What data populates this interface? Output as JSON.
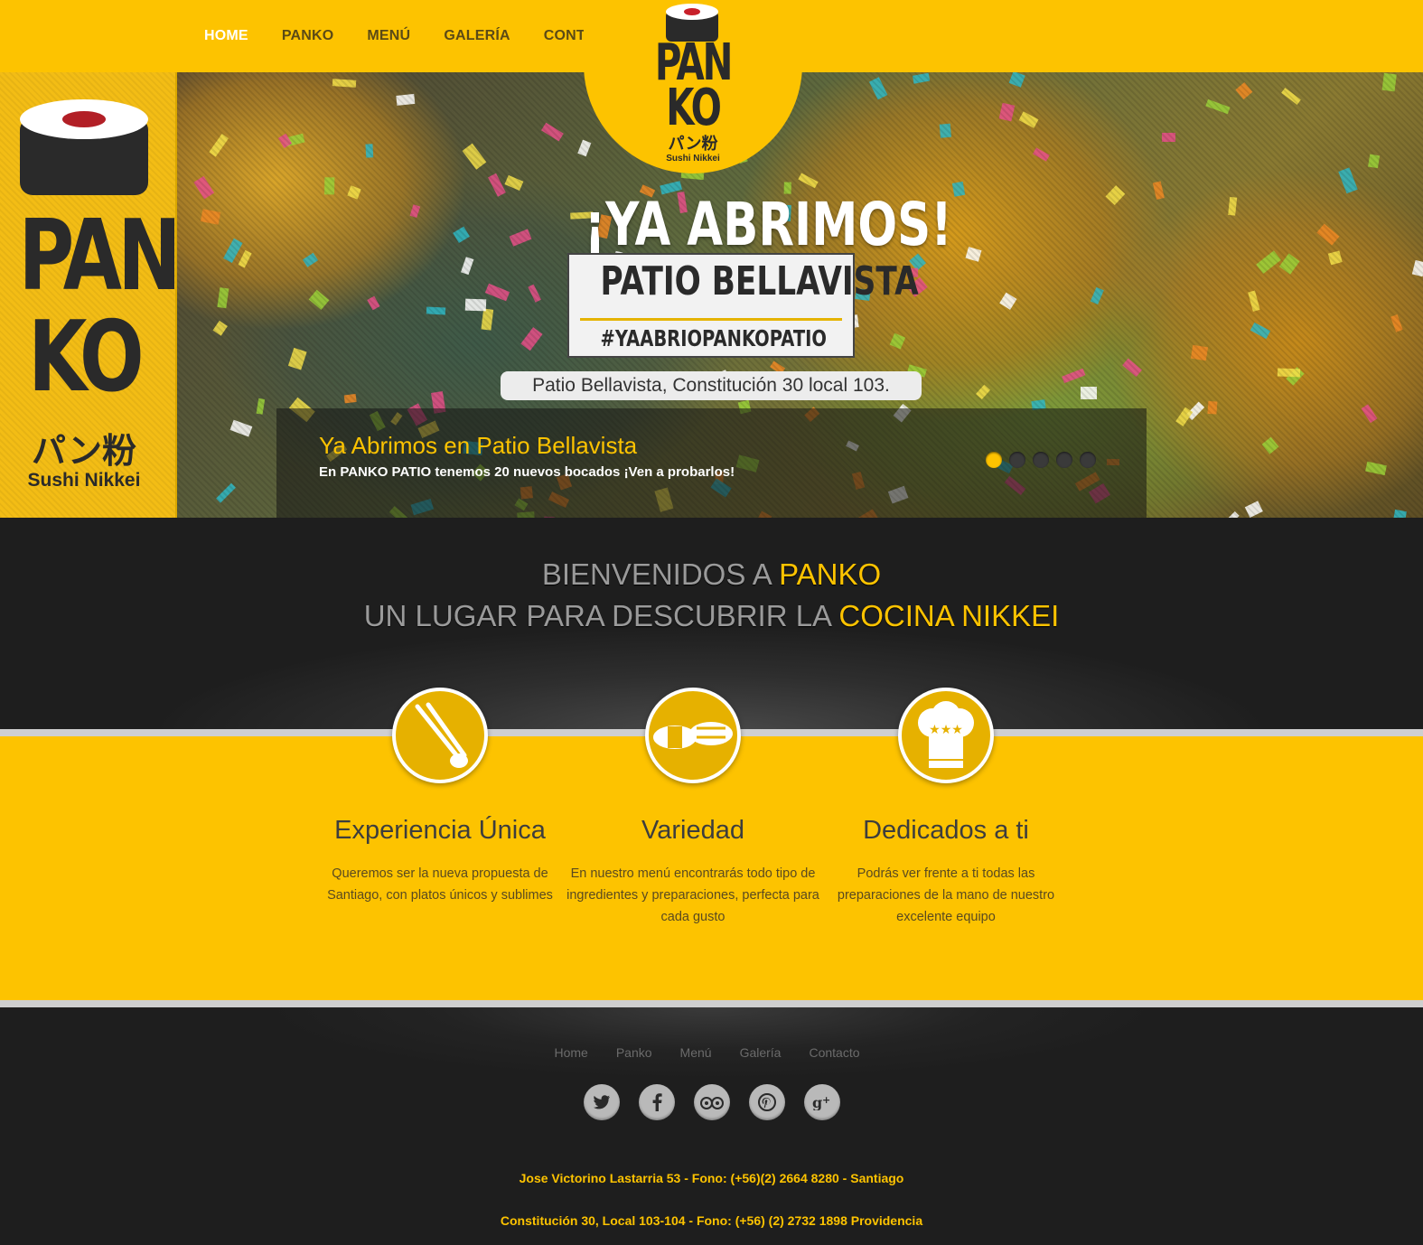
{
  "nav": {
    "items": [
      "HOME",
      "PANKO",
      "MENÚ",
      "GALERÍA",
      "CONTACTO"
    ]
  },
  "brand": {
    "line1": "PAN",
    "line2": "KO",
    "kana": "パン粉",
    "subtitle": "Sushi Nikkei"
  },
  "hero": {
    "title": "¡YA ABRIMOS!",
    "box_title": "PATIO BELLAVISTA",
    "hashtag": "#YAABRIOPANKOPATIO",
    "address": "Patio Bellavista, Constitución 30 local 103.",
    "caption_title": "Ya Abrimos en Patio Bellavista",
    "caption_text": "En PANKO PATIO tenemos 20 nuevos bocados ¡Ven a probarlos!",
    "slide_count": 5,
    "active_slide": 1
  },
  "welcome": {
    "line1_prefix": "BIENVENIDOS A ",
    "line1_highlight": "PANKO",
    "line2_prefix": "UN LUGAR PARA DESCUBRIR LA ",
    "line2_highlight": "COCINA NIKKEI"
  },
  "features": [
    {
      "icon": "chopsticks-icon",
      "title": "Experiencia Única",
      "text": "Queremos ser la nueva propuesta de Santiago, con platos únicos y sublimes"
    },
    {
      "icon": "sushi-icon",
      "title": "Variedad",
      "text": "En nuestro menú encontrarás todo tipo de ingredientes y preparaciones, perfecta para cada gusto"
    },
    {
      "icon": "chef-hat-icon",
      "title": "Dedicados a ti",
      "text": "Podrás ver frente a ti todas las preparaciones de la mano de nuestro excelente equipo"
    }
  ],
  "footer": {
    "nav": [
      "Home",
      "Panko",
      "Menú",
      "Galería",
      "Contacto"
    ],
    "social": [
      "twitter-icon",
      "facebook-icon",
      "tripadvisor-icon",
      "pinterest-icon",
      "google-plus-icon"
    ],
    "address1": "Jose Victorino Lastarria 53 - Fono: (+56)(2) 2664 8280 - Santiago",
    "address2": "Constitución 30, Local 103-104 - Fono: (+56) (2) 2732 1898 Providencia"
  },
  "colors": {
    "brand_yellow": "#fdc300",
    "dark": "#202020",
    "nav_text": "#5b4a16"
  }
}
